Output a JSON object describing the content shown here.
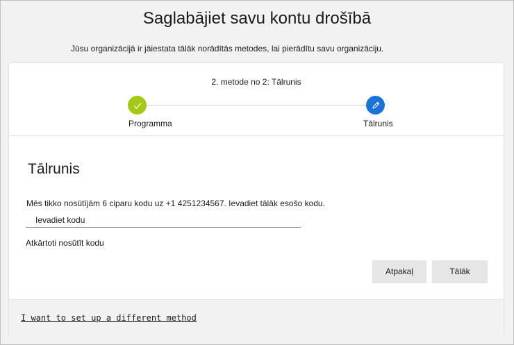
{
  "header": {
    "title": "Saglabājiet savu kontu drošībā",
    "subtitle": "Jūsu organizācijā ir jāiestata tālāk norādītās metodes, lai pierādītu savu organizāciju."
  },
  "progress": {
    "step_text": "2. metode no 2: Tālrunis",
    "steps": [
      {
        "label": "Programma",
        "status": "done",
        "icon": "check-icon"
      },
      {
        "label": "Tālrunis",
        "status": "active",
        "icon": "pencil-icon"
      }
    ]
  },
  "form": {
    "title": "Tālrunis",
    "description": "Mēs tikko nosūtījām 6 ciparu kodu uz +1 4251234567. Ievadiet tālāk esošo kodu.",
    "code_placeholder": "Ievadiet kodu",
    "resend_label": "Atkārtoti nosūtīt kodu",
    "back_label": "Atpakaļ",
    "next_label": "Tālāk"
  },
  "footer": {
    "link_label": "I want to set up a different method"
  },
  "colors": {
    "done": "#a4c914",
    "active": "#1a73d9",
    "background": "#f2f2f2",
    "button": "#e6e6e6"
  }
}
